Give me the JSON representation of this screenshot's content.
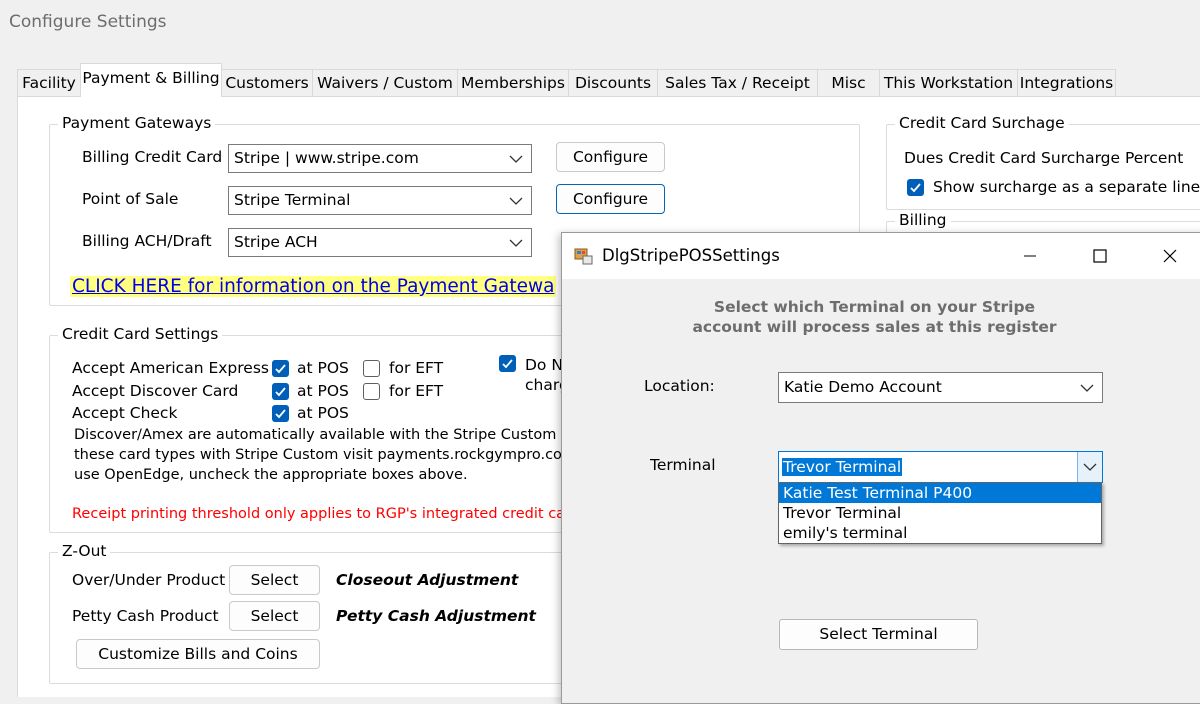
{
  "window": {
    "title": "Configure Settings"
  },
  "tabs": [
    {
      "label": "Facility"
    },
    {
      "label": "Payment & Billing",
      "active": true
    },
    {
      "label": "Customers"
    },
    {
      "label": "Waivers / Custom"
    },
    {
      "label": "Memberships"
    },
    {
      "label": "Discounts"
    },
    {
      "label": "Sales Tax / Receipt"
    },
    {
      "label": "Misc"
    },
    {
      "label": "This Workstation"
    },
    {
      "label": "Integrations"
    }
  ],
  "payment_gateways": {
    "legend": "Payment Gateways",
    "billing_cc_label": "Billing Credit Card",
    "billing_cc_value": "Stripe | www.stripe.com",
    "pos_label": "Point of Sale",
    "pos_value": "Stripe Terminal",
    "ach_label": "Billing ACH/Draft",
    "ach_value": "Stripe ACH",
    "configure_label": "Configure",
    "info_link": "CLICK HERE for information on the Payment Gatewa"
  },
  "credit_card_settings": {
    "legend": "Credit Card Settings",
    "amex_label": "Accept American Express",
    "discover_label": "Accept Discover Card",
    "check_label": "Accept Check",
    "at_pos": "at POS",
    "for_eft": "for EFT",
    "do_n_1": "Do N",
    "do_n_2": "charg",
    "note_1": "Discover/Amex are automatically available with the Stripe Custom and",
    "note_2": "these card types with Stripe Custom visit payments.rockgympro.com a",
    "note_3": "use OpenEdge, uncheck the appropriate boxes above.",
    "receipt_note": "Receipt printing threshold only applies to RGP's integrated credit card",
    "red_color": "#ff0000"
  },
  "z_out": {
    "legend": "Z-Out",
    "over_under_label": "Over/Under Product",
    "petty_cash_label": "Petty Cash Product",
    "select_label": "Select",
    "closeout_value": "Closeout Adjustment",
    "petty_value": "Petty Cash Adjustment",
    "customize_label": "Customize Bills and Coins"
  },
  "surcharge": {
    "legend": "Credit Card Surchage",
    "dues_label": "Dues Credit Card Surcharge Percent",
    "show_label": "Show surcharge as a separate line iter"
  },
  "billing": {
    "legend": "Billing"
  },
  "dialog": {
    "title": "DlgStripePOSSettings",
    "instruction": "Select which Terminal on your Stripe\naccount will process sales at this register",
    "location_label": "Location:",
    "location_value": "Katie Demo Account",
    "terminal_label": "Terminal",
    "terminal_value": "Trevor Terminal",
    "terminal_options": [
      {
        "label": "Katie Test Terminal P400",
        "highlighted": true
      },
      {
        "label": "Trevor Terminal"
      },
      {
        "label": "emily's terminal"
      }
    ],
    "select_terminal_label": "Select Terminal",
    "accent": "#0078d7"
  }
}
